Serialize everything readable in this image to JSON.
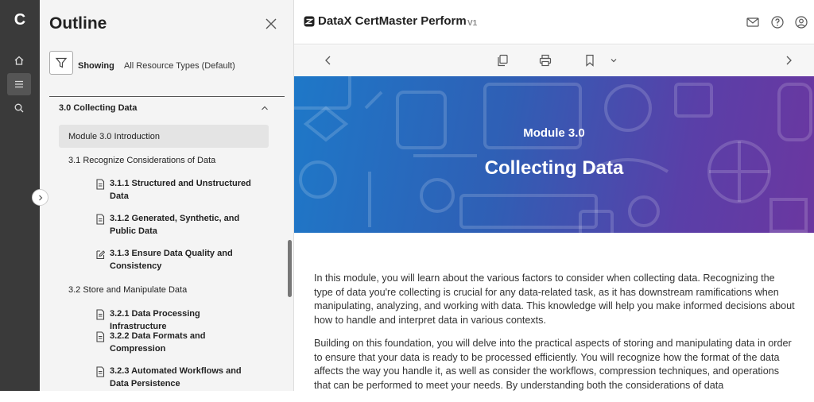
{
  "rail": {
    "logo": "C",
    "items": [
      "home-icon",
      "list-icon",
      "search-icon"
    ]
  },
  "outline": {
    "title": "Outline",
    "filter": {
      "showing_label": "Showing",
      "resource_types": "All Resource Types (Default)"
    },
    "section": "3.0 Collecting Data",
    "items": [
      {
        "label": "Module 3.0 Introduction"
      },
      {
        "label": "3.1 Recognize Considerations of Data"
      },
      {
        "label": "3.1.1 Structured and Unstructured Data",
        "icon": "document-icon"
      },
      {
        "label": "3.1.2 Generated, Synthetic, and Public Data",
        "icon": "document-icon"
      },
      {
        "label": "3.1.3 Ensure Data Quality and Consistency",
        "icon": "edit-icon"
      },
      {
        "label": "3.2 Store and Manipulate Data"
      },
      {
        "label": "3.2.1 Data Processing Infrastructure",
        "icon": "document-icon"
      },
      {
        "label": "3.2.2 Data Formats and Compression",
        "icon": "document-icon"
      },
      {
        "label": "3.2.3 Automated Workflows and Data Persistence",
        "icon": "document-icon"
      }
    ]
  },
  "header": {
    "brand": "DataX CertMaster Perform",
    "version": "V1",
    "icons": [
      "mail-icon",
      "help-icon",
      "user-icon"
    ]
  },
  "toolbar": {
    "icons": [
      "chevron-left-icon",
      "copy-icon",
      "print-icon",
      "bookmark-icon",
      "chevron-down-icon",
      "chevron-right-icon"
    ]
  },
  "hero": {
    "module": "Module 3.0",
    "title": "Collecting Data"
  },
  "content": {
    "paragraphs": [
      "In this module, you will learn about the various factors to consider when collecting data. Recognizing the type of data you're collecting is crucial for any data-related task, as it has downstream ramifications when manipulating, analyzing, and working with data. This knowledge will help you make informed decisions about how to handle and interpret data in various contexts.",
      "Building on this foundation, you will delve into the practical aspects of storing and manipulating data in order to ensure that your data is ready to be processed efficiently. You will recognize how the format of the data affects the way you handle it, as well as consider the workflows, compression techniques, and operations that can be performed to meet your needs. By understanding both the considerations of data"
    ]
  },
  "colors": {
    "rail": "#3a3a3a",
    "hero_start": "#1e78c8",
    "hero_end": "#6b37a0"
  }
}
